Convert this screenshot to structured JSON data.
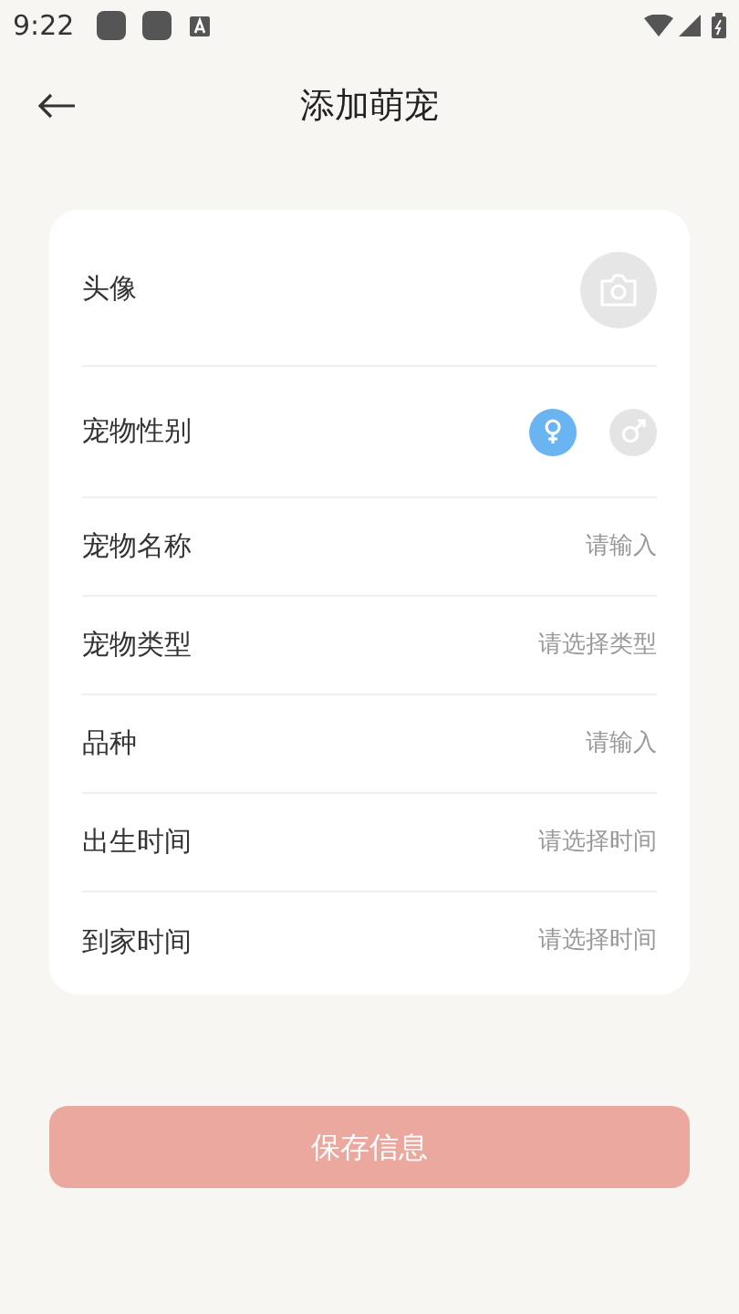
{
  "status_bar": {
    "time": "9:22"
  },
  "header": {
    "title": "添加萌宠"
  },
  "form": {
    "rows": [
      {
        "kind": "avatar",
        "label": "头像"
      },
      {
        "kind": "gender",
        "label": "宠物性别",
        "options": [
          {
            "kind": "female",
            "selected": true
          },
          {
            "kind": "male",
            "selected": false
          }
        ]
      },
      {
        "kind": "input",
        "label": "宠物名称",
        "placeholder": "请输入"
      },
      {
        "kind": "input",
        "label": "宠物类型",
        "placeholder": "请选择类型"
      },
      {
        "kind": "input",
        "label": "品种",
        "placeholder": "请输入"
      },
      {
        "kind": "input",
        "label": "出生时间",
        "placeholder": "请选择时间"
      },
      {
        "kind": "input",
        "label": "到家时间",
        "placeholder": "请选择时间"
      }
    ]
  },
  "save_button": {
    "label": "保存信息",
    "disabled": true
  }
}
